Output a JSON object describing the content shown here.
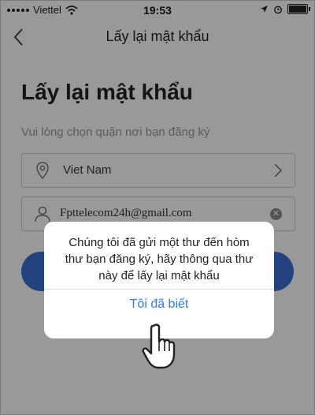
{
  "status_bar": {
    "carrier": "Viettel",
    "time": "19:53",
    "battery_level": 0.9
  },
  "nav": {
    "title": "Lấy lại mật khẩu"
  },
  "page": {
    "heading": "Lấy lại mật khẩu",
    "hint": "Vui lòng chọn quận nơi bạn đăng ký",
    "country": "Viet Nam",
    "email_value": "Fpttelecom24h@gmail.com"
  },
  "dialog": {
    "message": "Chúng tôi đã gửi một thư đến hòm thư bạn đăng ký, hãy thông qua thư này để lấy lại mật khẩu",
    "button": "Tôi đã biết"
  },
  "colors": {
    "accent": "#3b6fd6",
    "link": "#2f7df6",
    "overlay": "rgba(0,0,0,0.4)"
  },
  "icons": [
    "chevron-left-icon",
    "location-pin-icon",
    "chevron-right-icon",
    "user-icon",
    "clear-icon",
    "wifi-icon",
    "location-arrow-icon",
    "alarm-icon",
    "battery-icon",
    "hand-pointer-icon"
  ]
}
